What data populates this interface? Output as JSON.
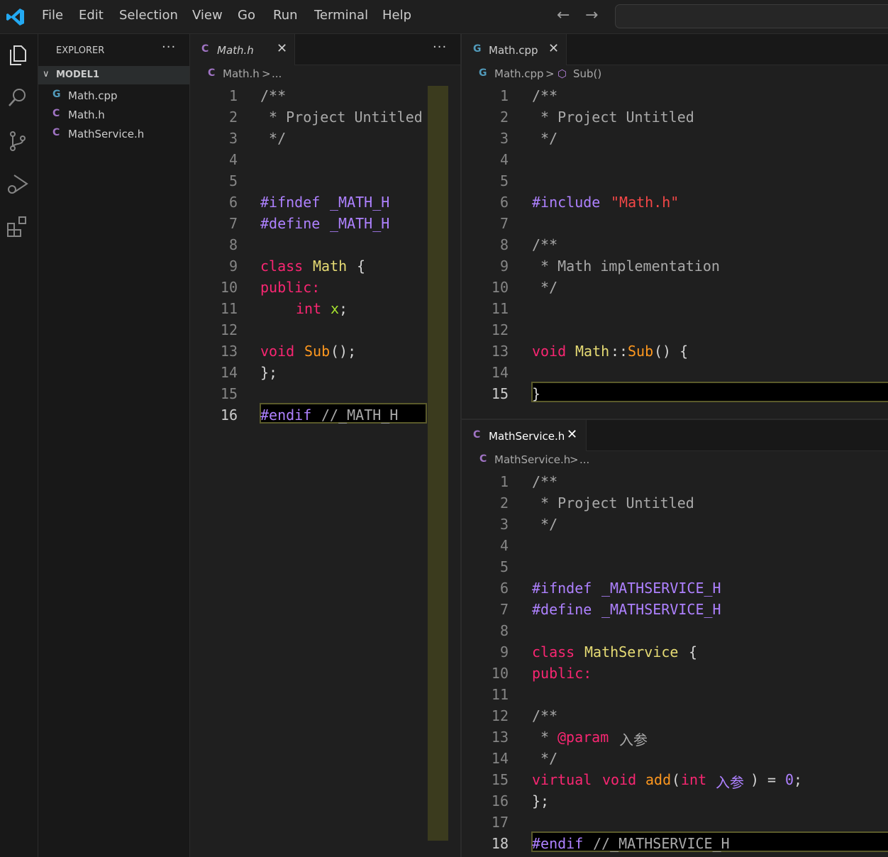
{
  "menu": [
    "File",
    "Edit",
    "Selection",
    "View",
    "Go",
    "Run",
    "Terminal",
    "Help"
  ],
  "explorer": {
    "title": "EXPLORER",
    "more": "···",
    "folder": "MODEL1",
    "files": [
      {
        "name": "Math.cpp",
        "icon": "G"
      },
      {
        "name": "Math.h",
        "icon": "C"
      },
      {
        "name": "MathService.h",
        "icon": "C"
      }
    ]
  },
  "left_editor": {
    "tab": {
      "icon": "C",
      "label": "Math.h",
      "close": "✕"
    },
    "more": "···",
    "breadcrumb": {
      "icon": "C",
      "file": "Math.h",
      "sep": ">",
      "rest": "..."
    },
    "lines": [
      "1",
      "2",
      "3",
      "4",
      "5",
      "6",
      "7",
      "8",
      "9",
      "10",
      "11",
      "12",
      "13",
      "14",
      "15",
      "16"
    ],
    "active_line": "16"
  },
  "right_top_editor": {
    "tab": {
      "icon": "G",
      "label": "Math.cpp",
      "close": "✕"
    },
    "breadcrumb": {
      "icon": "G",
      "file": "Math.cpp",
      "sep": ">",
      "symbol_icon": "⬡",
      "symbol": "Sub()"
    },
    "lines": [
      "1",
      "2",
      "3",
      "4",
      "5",
      "6",
      "7",
      "8",
      "9",
      "10",
      "11",
      "12",
      "13",
      "14",
      "15"
    ],
    "active_line": "15"
  },
  "right_bottom_editor": {
    "tab": {
      "icon": "C",
      "label": "MathService.h",
      "close": "✕"
    },
    "breadcrumb": {
      "icon": "C",
      "file": "MathService.h",
      "sep": ">",
      "rest": "..."
    },
    "lines": [
      "1",
      "2",
      "3",
      "4",
      "5",
      "6",
      "7",
      "8",
      "9",
      "10",
      "11",
      "12",
      "13",
      "14",
      "15",
      "16",
      "17",
      "18"
    ],
    "active_line": "18"
  },
  "code": {
    "doc_open": "/**",
    "doc_project": " * Project Untitled",
    "doc_close": " */",
    "ifndef": "#ifndef",
    "define": "#define",
    "endif": "#endif",
    "math_guard": "_MATH_H",
    "math_guard_comment": "//_MATH_H",
    "kw_class": "class",
    "cls_math": "Math",
    "brace_open": "{",
    "kw_public": "public:",
    "kw_int": "int",
    "var_x": "x",
    "semi": ";",
    "kw_void": "void",
    "fn_sub": "Sub",
    "call_end": "();",
    "class_end": "};",
    "include": "#include",
    "include_path": "\"Math.h\"",
    "doc_impl": " * Math implementation",
    "scope": "::",
    "parens_open": "() {",
    "brace_close": "}",
    "svc_guard": "_MATHSERVICE_H",
    "svc_guard_comment": "//_MATHSERVICE_H",
    "cls_service": "MathService",
    "doc_star": " * ",
    "param_tag": "@param",
    "param_name": "入参",
    "kw_virtual": "virtual",
    "fn_add": "add",
    "paren_open": "(",
    "paren_close": ")",
    "assign": " = ",
    "zero": "0"
  },
  "colors": {
    "preprocessor": "#ae81ff",
    "keyword": "#f92672",
    "class_name": "#e6db74",
    "function": "#fd971f",
    "variable": "#a6e22e",
    "comment": "#a9a9a9"
  }
}
